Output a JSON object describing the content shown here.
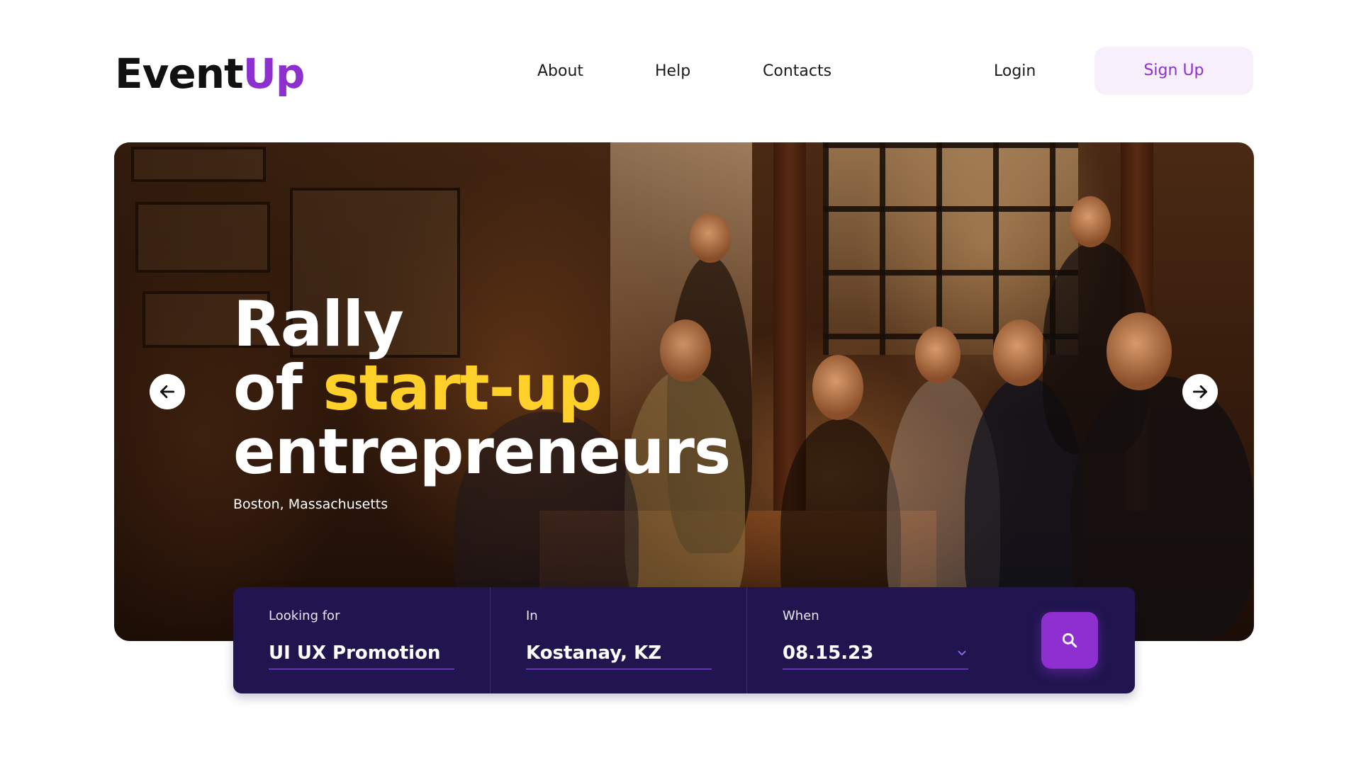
{
  "brand": {
    "logo_main": "Event",
    "logo_accent": "Up",
    "accent_color": "#8e2fd0"
  },
  "nav": {
    "items": [
      {
        "label": "About"
      },
      {
        "label": "Help"
      },
      {
        "label": "Contacts"
      }
    ],
    "login_label": "Login",
    "signup_label": "Sign Up"
  },
  "hero": {
    "title_line1": "Rally",
    "title_line2_prefix": "of ",
    "title_line2_highlight": "start-up",
    "title_line3": "entrepreneurs",
    "location": "Boston, Massachusetts",
    "highlight_color": "#ffd02a",
    "prev_icon": "arrow-left-icon",
    "next_icon": "arrow-right-icon"
  },
  "search": {
    "background_color": "#21154f",
    "fields": [
      {
        "label": "Looking for",
        "value": "UI UX Promotion"
      },
      {
        "label": "In",
        "value": "Kostanay, KZ"
      },
      {
        "label": "When",
        "value": "08.15.23"
      }
    ],
    "when_icon": "chevron-down-icon",
    "button_icon": "search-icon"
  }
}
